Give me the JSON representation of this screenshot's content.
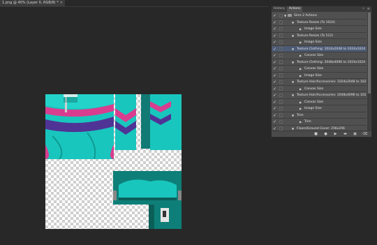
{
  "document": {
    "tab_title": "1.png @ 40% (Layer 0, RGB/8) *",
    "close_glyph": "×"
  },
  "panel": {
    "tabs": [
      "History",
      "Actions"
    ],
    "active_tab": "Actions",
    "collapse_glyph": "»",
    "menu_glyph": "≡",
    "rows": [
      {
        "label": "Sims 2 Actions",
        "level": 0,
        "checked": true,
        "selected": false,
        "is_set": true
      },
      {
        "label": "Texture Resize (To 1024)",
        "level": 1,
        "checked": true,
        "selected": false
      },
      {
        "label": "Image Size",
        "level": 2,
        "checked": true,
        "selected": false
      },
      {
        "label": "Texture Resize (To 512)",
        "level": 1,
        "checked": true,
        "selected": false
      },
      {
        "label": "Image Size",
        "level": 2,
        "checked": true,
        "selected": false
      },
      {
        "label": "Texture Clothing: 1024x2048 to 1024x1024",
        "level": 1,
        "checked": true,
        "selected": true
      },
      {
        "label": "Canvas Size",
        "level": 2,
        "checked": true,
        "selected": false
      },
      {
        "label": "Texture Clothing: 2048x4096 to 1024x1024",
        "level": 1,
        "checked": true,
        "selected": false
      },
      {
        "label": "Canvas Size",
        "level": 2,
        "checked": true,
        "selected": false
      },
      {
        "label": "Image Size",
        "level": 2,
        "checked": true,
        "selected": false
      },
      {
        "label": "Texture Hair/Accessories: 1024x2048 to 102...",
        "level": 1,
        "checked": true,
        "selected": false
      },
      {
        "label": "Canvas Size",
        "level": 2,
        "checked": true,
        "selected": false
      },
      {
        "label": "Texture Hair/Accessories: 2048x4096 to 102...",
        "level": 1,
        "checked": true,
        "selected": false
      },
      {
        "label": "Canvas Size",
        "level": 2,
        "checked": true,
        "selected": false
      },
      {
        "label": "Image Size",
        "level": 2,
        "checked": true,
        "selected": false
      },
      {
        "label": "Trim",
        "level": 1,
        "checked": true,
        "selected": false
      },
      {
        "label": "Trim",
        "level": 2,
        "checked": true,
        "selected": false
      },
      {
        "label": "Floors/Ground Cover: 256x256",
        "level": 1,
        "checked": true,
        "selected": false
      }
    ],
    "footer_buttons": [
      {
        "name": "stop-icon",
        "glyph": "■"
      },
      {
        "name": "record-icon",
        "glyph": "●"
      },
      {
        "name": "play-icon",
        "glyph": "▶"
      },
      {
        "name": "new-set-icon",
        "glyph": "▬"
      },
      {
        "name": "new-action-icon",
        "glyph": "▣"
      },
      {
        "name": "delete-icon",
        "glyph": "⌫"
      }
    ]
  },
  "colors": {
    "teal": "#19c6bd",
    "teal_dark": "#0e7f78",
    "pink": "#d93d8f",
    "purple": "#4f3496",
    "selection": "#4d5b75"
  }
}
